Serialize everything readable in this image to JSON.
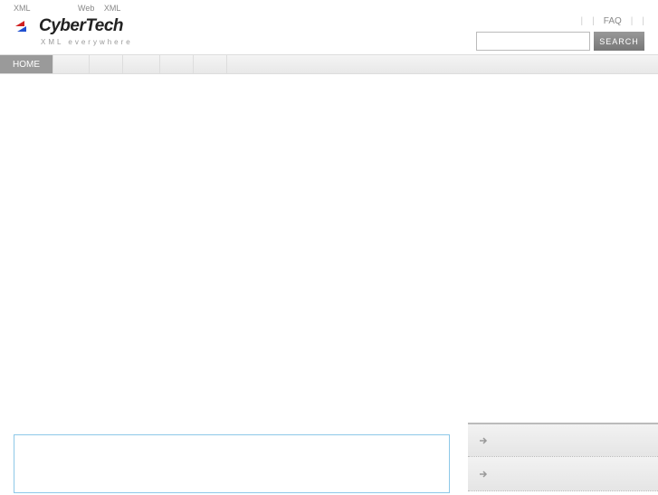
{
  "top_text": {
    "xml1": "XML",
    "web": "Web",
    "xml2": "XML"
  },
  "logo": {
    "name": "CyberTech",
    "tagline": "XML everywhere"
  },
  "top_links": {
    "faq": "FAQ"
  },
  "search": {
    "button": "SEARCH",
    "value": ""
  },
  "nav": {
    "home": "HOME"
  }
}
